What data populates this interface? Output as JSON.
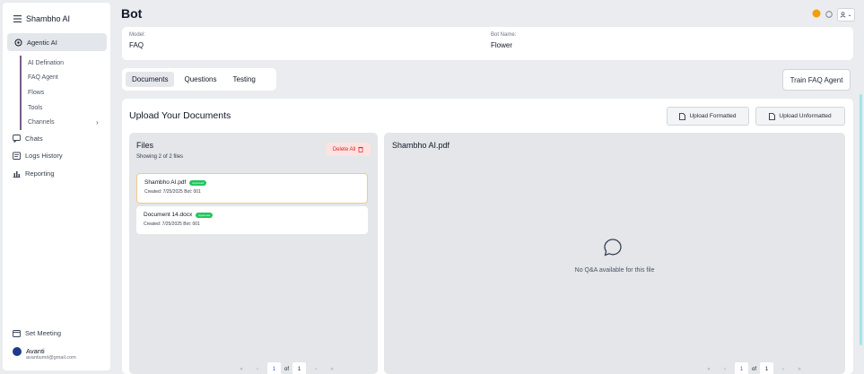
{
  "sidebar": {
    "brand": "Shambho AI",
    "active_item": "Agentic AI",
    "sub_items": [
      "AI Defination",
      "FAQ Agent",
      "Flows",
      "Tools",
      "Channels"
    ],
    "items": [
      "Chats",
      "Logs History",
      "Reporting"
    ],
    "set_meeting": "Set Meeting",
    "user_name": "Avanti",
    "user_email": "avantiumit@gmail.com"
  },
  "header": {
    "title": "Bot",
    "user_menu_icon": "user-icon"
  },
  "bot_info": {
    "model_label": "Model:",
    "model_value": "FAQ",
    "name_label": "Bot Name:",
    "name_value": "Flower"
  },
  "tabs": [
    "Documents",
    "Questions",
    "Testing"
  ],
  "train_button": "Train FAQ Agent",
  "upload": {
    "title": "Upload Your Documents",
    "formatted": "Upload Formatted",
    "unformatted": "Upload Unformatted"
  },
  "files": {
    "title": "Files",
    "count_text": "Showing 2 of 2 files",
    "delete_all": "Delete All",
    "items": [
      {
        "name": "Shambho AI.pdf",
        "badge": "Approved",
        "meta": "Created: 7/25/2025  Bot: 001"
      },
      {
        "name": "Document 14.docx",
        "badge": "Approved",
        "meta": "Created: 7/25/2025  Bot: 001"
      }
    ]
  },
  "preview": {
    "title": "Shambho AI.pdf",
    "empty": "No Q&A available for this file"
  },
  "pagination": {
    "current": "1",
    "of": "of",
    "total": "1"
  },
  "colors": {
    "accent_purple": "#7a5b8a",
    "approved_green": "#22c55e",
    "danger": "#dc2626",
    "selected_border": "#f2c98a"
  }
}
